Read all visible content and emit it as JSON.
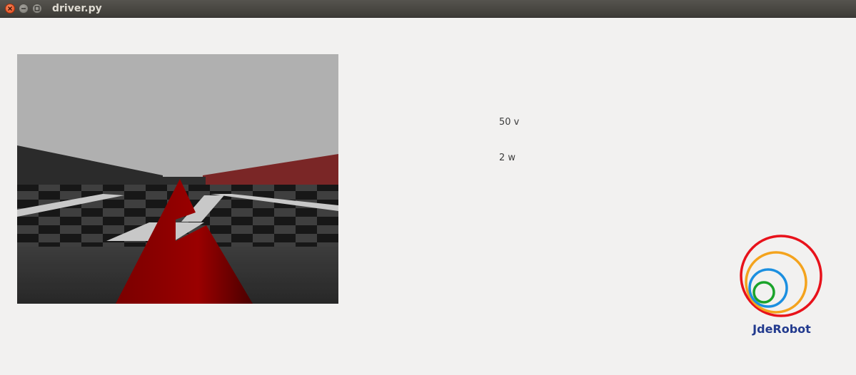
{
  "window": {
    "title": "driver.py"
  },
  "readouts": {
    "v": "50 v",
    "w": "2 w"
  },
  "logo": {
    "text": "JdeRobot",
    "ring_colors": [
      "#e8121b",
      "#f4a31d",
      "#1b8fe0",
      "#1aa32a"
    ],
    "text_color": "#223a8e"
  },
  "camera": {
    "sky_color": "#b0b0b0",
    "left_wall_color": "#2b2b2b",
    "right_wall_color": "#7a2626",
    "line_color": "#c8c8c8",
    "car_color": "#8a0000"
  }
}
